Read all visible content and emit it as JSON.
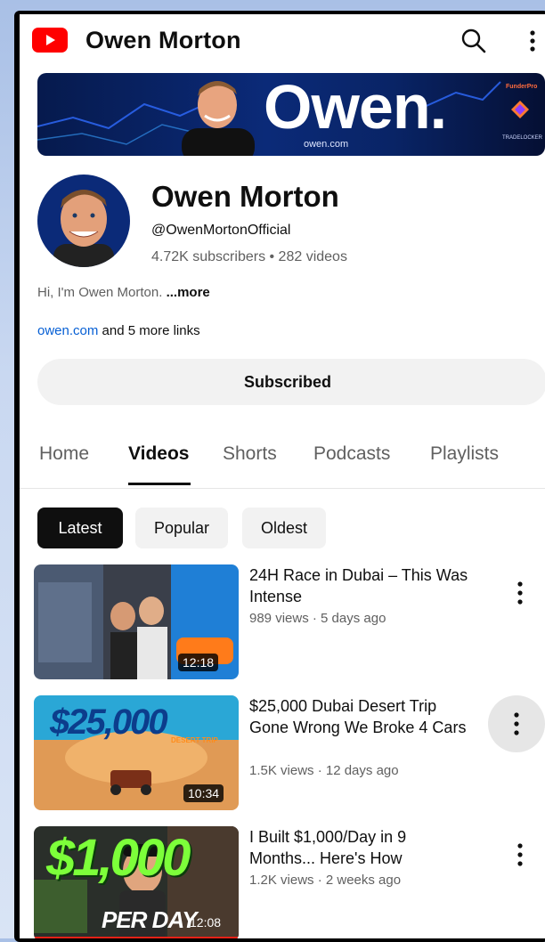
{
  "header": {
    "title": "Owen Morton"
  },
  "banner": {
    "wordmark": "Owen.",
    "url": "owen.com",
    "sponsor_top": "FunderPro",
    "sponsor_bottom": "TRADELOCKER"
  },
  "channel": {
    "name": "Owen Morton",
    "handle": "@OwenMortonOfficial",
    "stats": "4.72K subscribers • 282 videos",
    "description": "Hi, I'm Owen Morton. ",
    "description_more": "...more",
    "link_url": "owen.com",
    "link_more": " and 5 more links",
    "subscribe_label": "Subscribed"
  },
  "tabs": [
    "Home",
    "Videos",
    "Shorts",
    "Podcasts",
    "Playlists"
  ],
  "active_tab": "Videos",
  "chips": [
    "Latest",
    "Popular",
    "Oldest"
  ],
  "active_chip": "Latest",
  "videos": [
    {
      "title": "24H Race in Dubai – This Was Intense",
      "meta": "989 views · 5 days ago",
      "duration": "12:18"
    },
    {
      "title": "$25,000 Dubai Desert Trip Gone Wrong We Broke 4 Cars",
      "meta": "1.5K views · 12 days ago",
      "duration": "10:34",
      "thumb_text": "$25,000",
      "thumb_sub": "DESERT TRIP"
    },
    {
      "title": "I Built $1,000/Day in 9 Months... Here's How",
      "meta": "1.2K views · 2 weeks ago",
      "duration": "12:08",
      "thumb_text": "$1,000",
      "thumb_sub": "PER DAY"
    }
  ],
  "colors": {
    "brand_red": "#ff0000",
    "link_blue": "#065fd4",
    "text_primary": "#0f0f0f",
    "text_secondary": "#606060"
  }
}
